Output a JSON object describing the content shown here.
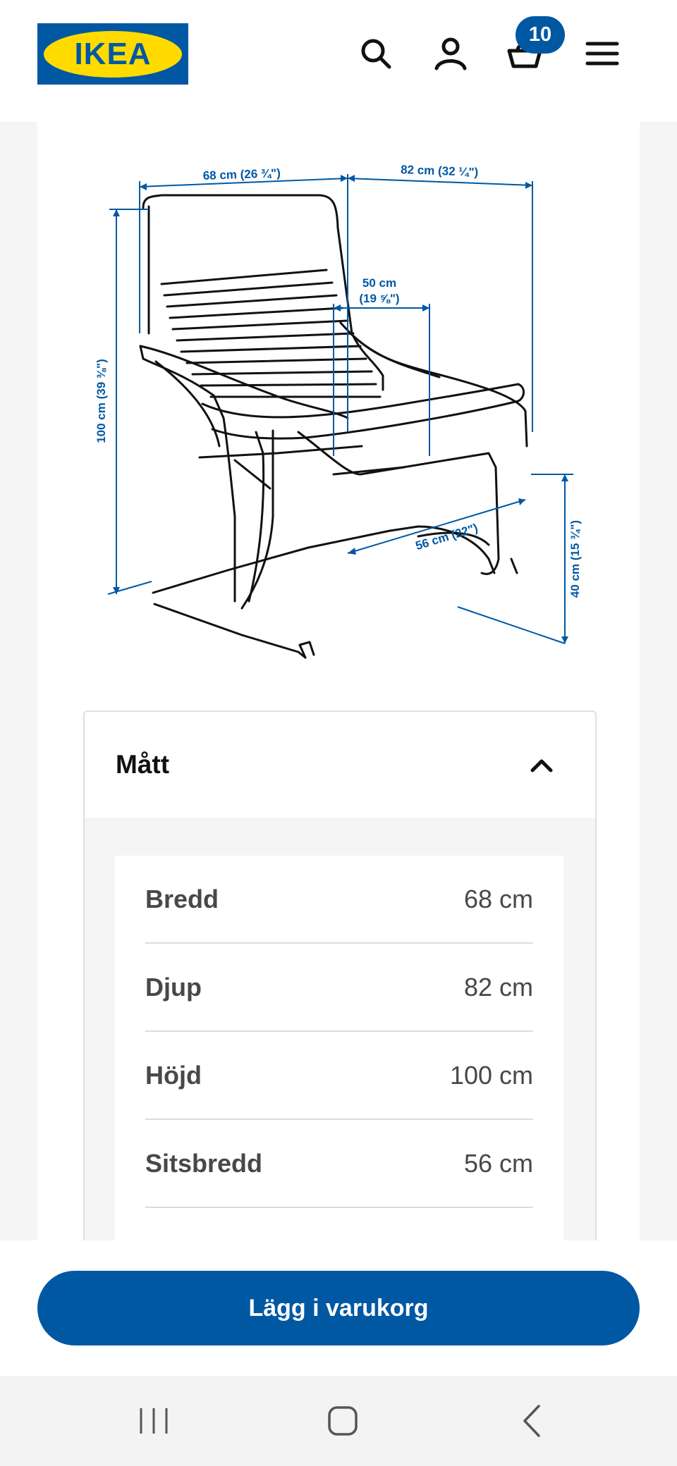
{
  "header": {
    "logo_text": "IKEA",
    "icons": [
      "search-icon",
      "account-icon",
      "cart-icon",
      "menu-icon"
    ],
    "cart_count": "10",
    "colors": {
      "brand_blue": "#0058a3",
      "brand_yellow": "#ffdb00"
    }
  },
  "diagram": {
    "labels": {
      "width": "68 cm (26 ¾\")",
      "depth": "82 cm (32 ¼\")",
      "seat_depth_cm": "50 cm",
      "seat_depth_in": "(19 ⅝\")",
      "height": "100 cm (39 ⅜\")",
      "seat_width": "56 cm (22\")",
      "seat_height": "40 cm (15 ¾\")"
    }
  },
  "dimensions": {
    "title": "Mått",
    "rows": [
      {
        "label": "Bredd",
        "value": "68 cm"
      },
      {
        "label": "Djup",
        "value": "82 cm"
      },
      {
        "label": "Höjd",
        "value": "100 cm"
      },
      {
        "label": "Sitsbredd",
        "value": "56 cm"
      }
    ]
  },
  "cart": {
    "button_label": "Lägg i varukorg"
  },
  "android_nav": {
    "icons": [
      "recent-apps-icon",
      "home-icon",
      "back-icon"
    ]
  }
}
